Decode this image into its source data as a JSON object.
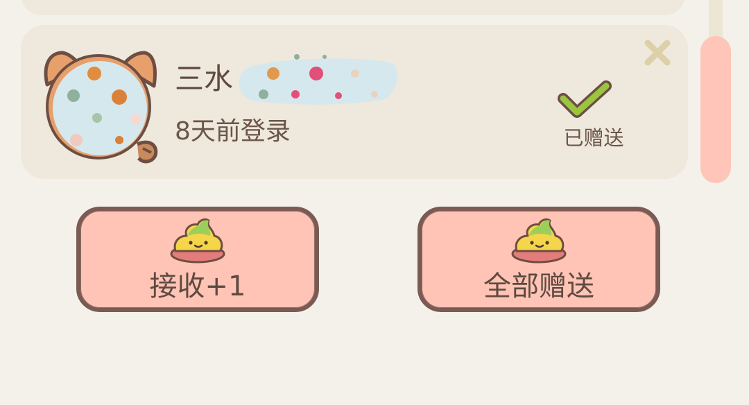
{
  "friend_card": {
    "name": "三水",
    "last_login": "8天前登录",
    "status_label": "已赠送"
  },
  "buttons": {
    "receive": "接收+1",
    "gift_all": "全部赠送"
  },
  "icons": {
    "close": "close-x-icon",
    "gifted": "check-icon",
    "gift_item": "swirl-treat-icon"
  },
  "colors": {
    "background": "#f4f1ea",
    "card": "#efe8dc",
    "button": "#ffc4b6",
    "button_border": "#7a5a52",
    "check": "#9bc53d",
    "scroll_thumb": "#ffc5b8"
  }
}
